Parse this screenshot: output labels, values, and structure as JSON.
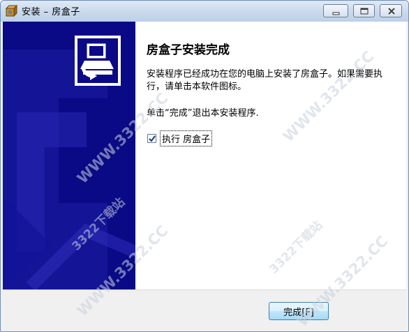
{
  "window": {
    "title": "安装 – 房盒子",
    "buttons": {
      "minimize": "minimize-icon",
      "maximize": "maximize-icon",
      "close": "close-icon"
    }
  },
  "content": {
    "heading": "房盒子安装完成",
    "description": "安装程序已经成功在您的电脑上安装了房盒子。如果需要执行，请单击本软件图标。",
    "exit_text": "单击“完成”退出本安装程序.",
    "run_option": {
      "label": "执行 房盒子",
      "checked": true
    }
  },
  "footer": {
    "finish_label": "完成",
    "finish_hotkey": "[F]"
  },
  "watermark": {
    "text": "WWW.3322.CC",
    "text_cn": "3322下载站"
  },
  "colors": {
    "side_panel": "#0a0a86",
    "accent_button_border": "#3c7fb1",
    "titlebar": "#c9d9ec"
  }
}
